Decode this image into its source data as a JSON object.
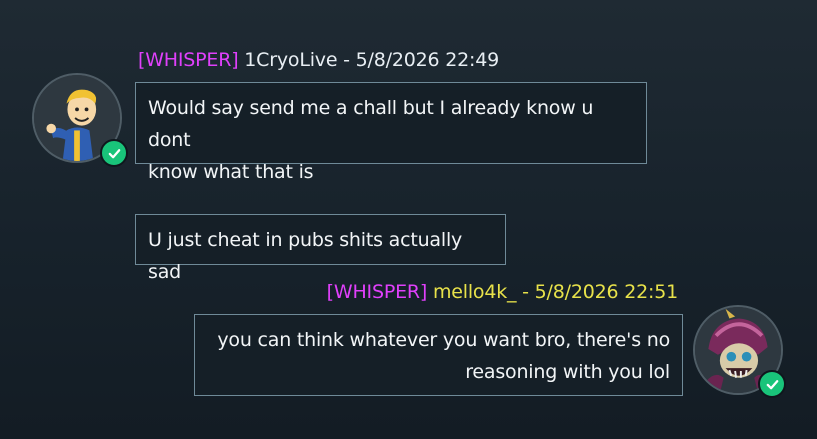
{
  "messages": [
    {
      "tag": "[WHISPER]",
      "sender": "1CryoLive",
      "timestamp": "5/8/2026 22:49",
      "sender_color": "#e8eef3",
      "avatar_icon": "vault-boy-avatar",
      "verified": true,
      "lines": [
        "Would say send me a chall but I already know u dont",
        "know what that is"
      ],
      "followup": "U just cheat in pubs shits actually sad"
    },
    {
      "tag": "[WHISPER]",
      "sender": "mello4k_",
      "timestamp": "5/8/2026 22:51",
      "sender_color": "#e8e24a",
      "avatar_icon": "samurai-skull-avatar",
      "verified": true,
      "lines": [
        "you can think whatever you want bro, there's no",
        "reasoning with you lol"
      ]
    }
  ],
  "colors": {
    "whisper_tag": "#e040fb",
    "bubble_border": "#6f8a98",
    "verified_badge": "#19c47a"
  },
  "separator": " - "
}
